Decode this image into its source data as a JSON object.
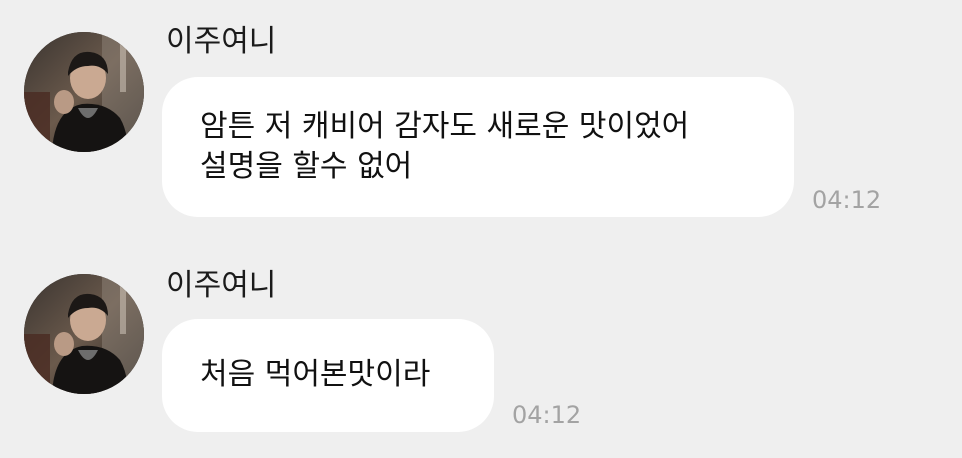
{
  "messages": [
    {
      "sender": "이주여니",
      "lines": [
        "암튼 저 캐비어 감자도 새로운 맛이었어",
        "설명을 할수 없어"
      ],
      "time": "04:12"
    },
    {
      "sender": "이주여니",
      "lines": [
        "처음 먹어본맛이라"
      ],
      "time": "04:12"
    }
  ],
  "colors": {
    "background": "#efefef",
    "bubble": "#ffffff",
    "timestamp": "#a3a3a3"
  },
  "icons": {
    "avatar": "profile-photo"
  }
}
